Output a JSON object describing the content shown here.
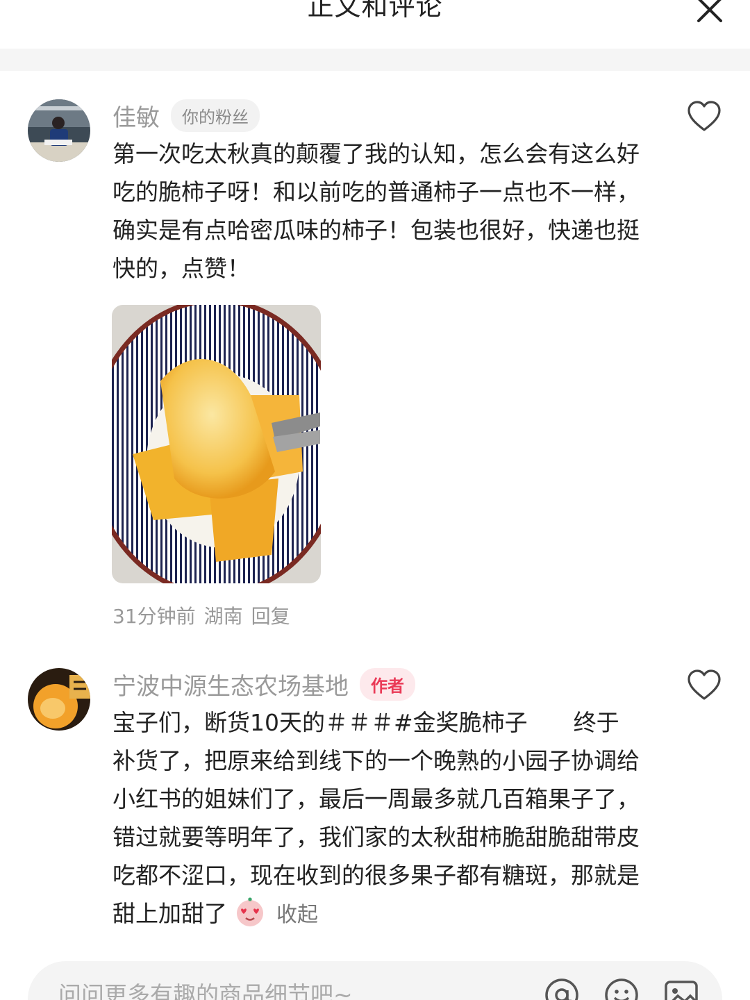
{
  "header": {
    "title": "正文和评论"
  },
  "comments": [
    {
      "username": "佳敏",
      "badge": "你的粉丝",
      "text": "第一次吃太秋真的颠覆了我的认知，怎么会有这么好吃的脆柿子呀！和以前吃的普通柿子一点也不一样，确实是有点哈密瓜味的柿子！包装也很好，快递也挺快的，点赞！",
      "time": "31分钟前",
      "location": "湖南",
      "reply_label": "回复"
    },
    {
      "username": "宁波中源生态农场基地",
      "badge": "作者",
      "text": "宝子们，断货10天的＃＃＃#金奖脆柿子　　终于补货了，把原来给到线下的一个晚熟的小园子协调给小红书的姐妹们了，最后一周最多就几百箱果子了，错过就要等明年了，我们家的太秋甜柿脆甜脆甜带皮吃都不涩口，现在收到的很多果子都有糖斑，那就是甜上加甜了",
      "collapse_label": "收起"
    }
  ],
  "input": {
    "placeholder": "问问更多有趣的商品细节吧~"
  },
  "colors": {
    "accent": "#ea3a57",
    "muted": "#999999"
  }
}
